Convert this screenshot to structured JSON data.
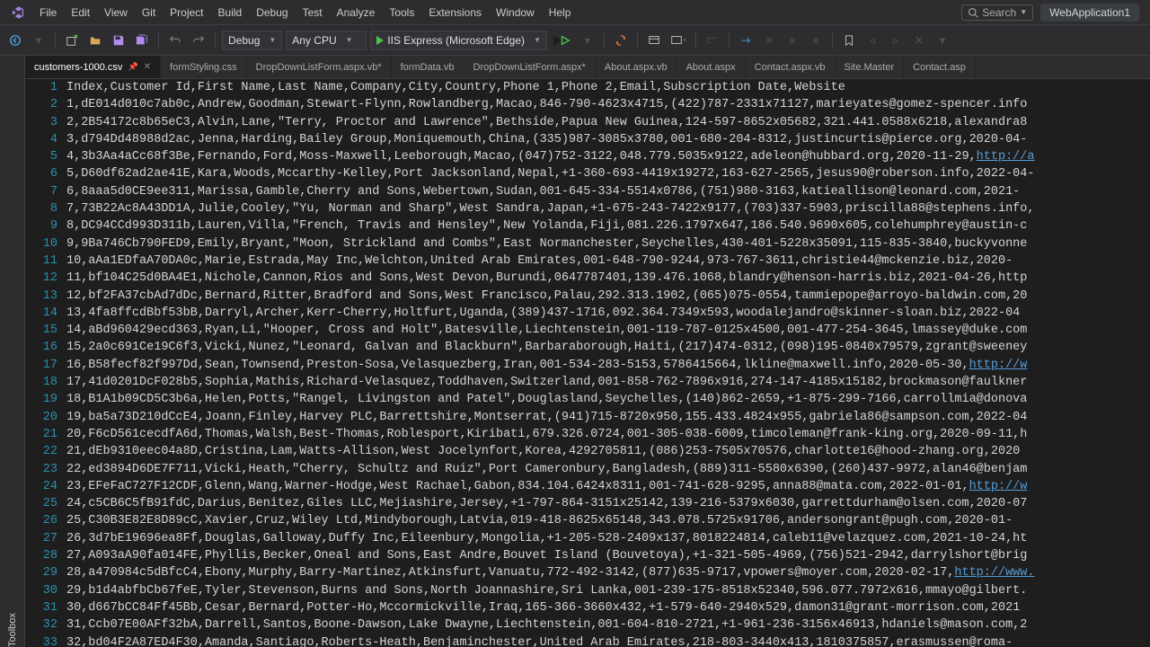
{
  "menubar": {
    "items": [
      "File",
      "Edit",
      "View",
      "Git",
      "Project",
      "Build",
      "Debug",
      "Test",
      "Analyze",
      "Tools",
      "Extensions",
      "Window",
      "Help"
    ],
    "search_label": "Search",
    "app_title": "WebApplication1"
  },
  "toolbar": {
    "config": "Debug",
    "platform": "Any CPU",
    "run_label": "IIS Express (Microsoft Edge)"
  },
  "sidebar": {
    "toolbox_label": "Toolbox"
  },
  "tabs": [
    {
      "label": "customers-1000.csv",
      "active": true,
      "pinned": true,
      "close": true
    },
    {
      "label": "formStyling.css"
    },
    {
      "label": "DropDownListForm.aspx.vb*"
    },
    {
      "label": "formData.vb"
    },
    {
      "label": "DropDownListForm.aspx*"
    },
    {
      "label": "About.aspx.vb"
    },
    {
      "label": "About.aspx"
    },
    {
      "label": "Contact.aspx.vb"
    },
    {
      "label": "Site.Master"
    },
    {
      "label": "Contact.asp"
    }
  ],
  "code": {
    "lines": [
      "Index,Customer Id,First Name,Last Name,Company,City,Country,Phone 1,Phone 2,Email,Subscription Date,Website",
      "1,dE014d010c7ab0c,Andrew,Goodman,Stewart-Flynn,Rowlandberg,Macao,846-790-4623x4715,(422)787-2331x71127,marieyates@gomez-spencer.info",
      "2,2B54172c8b65eC3,Alvin,Lane,\"Terry, Proctor and Lawrence\",Bethside,Papua New Guinea,124-597-8652x05682,321.441.0588x6218,alexandra8",
      "3,d794Dd48988d2ac,Jenna,Harding,Bailey Group,Moniquemouth,China,(335)987-3085x3780,001-680-204-8312,justincurtis@pierce.org,2020-04-",
      "4,3b3Aa4aCc68f3Be,Fernando,Ford,Moss-Maxwell,Leeborough,Macao,(047)752-3122,048.779.5035x9122,adeleon@hubbard.org,2020-11-29,http://a",
      "5,D60df62ad2ae41E,Kara,Woods,Mccarthy-Kelley,Port Jacksonland,Nepal,+1-360-693-4419x19272,163-627-2565,jesus90@roberson.info,2022-04-",
      "6,8aaa5d0CE9ee311,Marissa,Gamble,Cherry and Sons,Webertown,Sudan,001-645-334-5514x0786,(751)980-3163,katieallison@leonard.com,2021-",
      "7,73B22Ac8A43DD1A,Julie,Cooley,\"Yu, Norman and Sharp\",West Sandra,Japan,+1-675-243-7422x9177,(703)337-5903,priscilla88@stephens.info,",
      "8,DC94CCd993D311b,Lauren,Villa,\"French, Travis and Hensley\",New Yolanda,Fiji,081.226.1797x647,186.540.9690x605,colehumphrey@austin-c",
      "9,9Ba746Cb790FED9,Emily,Bryant,\"Moon, Strickland and Combs\",East Normanchester,Seychelles,430-401-5228x35091,115-835-3840,buckyvonne",
      "10,aAa1EDfaA70DA0c,Marie,Estrada,May Inc,Welchton,United Arab Emirates,001-648-790-9244,973-767-3611,christie44@mckenzie.biz,2020-",
      "11,bf104C25d0BA4E1,Nichole,Cannon,Rios and Sons,West Devon,Burundi,0647787401,139.476.1068,blandry@henson-harris.biz,2021-04-26,http",
      "12,bf2FA37cbAd7dDc,Bernard,Ritter,Bradford and Sons,West Francisco,Palau,292.313.1902,(065)075-0554,tammiepope@arroyo-baldwin.com,20",
      "13,4fa8ffcdBbf53bB,Darryl,Archer,Kerr-Cherry,Holtfurt,Uganda,(389)437-1716,092.364.7349x593,woodalejandro@skinner-sloan.biz,2022-04",
      "14,aBd960429ecd363,Ryan,Li,\"Hooper, Cross and Holt\",Batesville,Liechtenstein,001-119-787-0125x4500,001-477-254-3645,lmassey@duke.com",
      "15,2a0c691Ce19C6f3,Vicki,Nunez,\"Leonard, Galvan and Blackburn\",Barbaraborough,Haiti,(217)474-0312,(098)195-0840x79579,zgrant@sweeney",
      "16,B58fecf82f997Dd,Sean,Townsend,Preston-Sosa,Velasquezberg,Iran,001-534-283-5153,5786415664,lkline@maxwell.info,2020-05-30,http://w",
      "17,41d0201DcF028b5,Sophia,Mathis,Richard-Velasquez,Toddhaven,Switzerland,001-858-762-7896x916,274-147-4185x15182,brockmason@faulkner",
      "18,B1A1b09CD5C3b6a,Helen,Potts,\"Rangel, Livingston and Patel\",Douglasland,Seychelles,(140)862-2659,+1-875-299-7166,carrollmia@donova",
      "19,ba5a73D210dCcE4,Joann,Finley,Harvey PLC,Barrettshire,Montserrat,(941)715-8720x950,155.433.4824x955,gabriela86@sampson.com,2022-04",
      "20,F6cD561cecdfA6d,Thomas,Walsh,Best-Thomas,Roblesport,Kiribati,679.326.0724,001-305-038-6009,timcoleman@frank-king.org,2020-09-11,h",
      "21,dEb9310eec04a8D,Cristina,Lam,Watts-Allison,West Jocelynfort,Korea,4292705811,(086)253-7505x70576,charlotte16@hood-zhang.org,2020",
      "22,ed3894D6DE7F711,Vicki,Heath,\"Cherry, Schultz and Ruiz\",Port Cameronbury,Bangladesh,(889)311-5580x6390,(260)437-9972,alan46@benjam",
      "23,EFeFaC727F12CDF,Glenn,Wang,Warner-Hodge,West Rachael,Gabon,834.104.6424x8311,001-741-628-9295,anna88@mata.com,2022-01-01,http://w",
      "24,c5CB6C5fB91fdC,Darius,Benitez,Giles LLC,Mejiashire,Jersey,+1-797-864-3151x25142,139-216-5379x6030,garrettdurham@olsen.com,2020-07",
      "25,C30B3E82E8D89cC,Xavier,Cruz,Wiley Ltd,Mindyborough,Latvia,019-418-8625x65148,343.078.5725x91706,andersongrant@pugh.com,2020-01-",
      "26,3d7bE19696ea8Ff,Douglas,Galloway,Duffy Inc,Eileenbury,Mongolia,+1-205-528-2409x137,8018224814,caleb11@velazquez.com,2021-10-24,ht",
      "27,A093aA90fa014FE,Phyllis,Becker,Oneal and Sons,East Andre,Bouvet Island (Bouvetoya),+1-321-505-4969,(756)521-2942,darrylshort@brig",
      "28,a470984c5dBfcC4,Ebony,Murphy,Barry-Martinez,Atkinsfurt,Vanuatu,772-492-3142,(877)635-9717,vpowers@moyer.com,2020-02-17,http://www.",
      "29,b1d4abfbCb67feE,Tyler,Stevenson,Burns and Sons,North Joannashire,Sri Lanka,001-239-175-8518x52340,596.077.7972x616,mmayo@gilbert.",
      "30,d667bCC84Ff45Bb,Cesar,Bernard,Potter-Ho,Mccormickville,Iraq,165-366-3660x432,+1-579-640-2940x529,damon31@grant-morrison.com,2021",
      "31,Ccb07E00AFf32bA,Darrell,Santos,Boone-Dawson,Lake Dwayne,Liechtenstein,001-604-810-2721,+1-961-236-3156x46913,hdaniels@mason.com,2",
      "32,bd04F2A87ED4F30,Amanda,Santiago,Roberts-Heath,Benjaminchester,United Arab Emirates,218-803-3440x413,1810375857,erasmussen@roma-"
    ]
  }
}
